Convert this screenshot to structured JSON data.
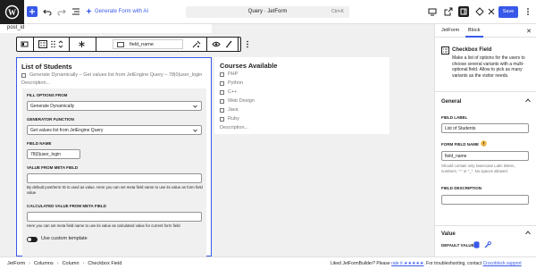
{
  "header": {
    "gen_ai_label": "Generate Form with AI",
    "command_title": "Query · JetForm",
    "command_shortcut": "Ctrl+K",
    "save_label": "Save"
  },
  "canvas": {
    "post_id_text": "post_id",
    "block_toolbar": {
      "field_name_value": "field_name"
    }
  },
  "main_field": {
    "title": "List of Students",
    "dynamic_label": "Generate Dynamically – Get values list from JetEngine Query – 78|0|user_login",
    "description_placeholder": "Description...",
    "fill_options_label": "FILL OPTIONS FROM",
    "fill_options_value": "Generate Dynamically",
    "generator_label": "GENERATOR FUNCTION",
    "generator_value": "Get values list from JetEngine Query",
    "field_name_label": "FIELD NAME",
    "field_name_value": "78|0|user_login",
    "meta_field_label": "VALUE FROM META FIELD",
    "meta_field_help": "By default post/term ID is used as value. Here you can set meta field name to use its value as form field value",
    "calc_label": "CALCULATED VALUE FROM META FIELD",
    "calc_help": "Here you can set meta field name to use its value as calculated value for current form field",
    "toggle_label": "Use custom template"
  },
  "courses_field": {
    "title": "Courses Available",
    "options": [
      "PHP",
      "Python",
      "C++",
      "Web Design",
      "Java",
      "Ruby"
    ],
    "description_placeholder": "Description..."
  },
  "sidebar": {
    "tabs": [
      "JetForm",
      "Block"
    ],
    "active_tab": "Block",
    "block_title": "Checkbox Field",
    "block_description": "Make a list of options for the users to choose several variants with a multi-optional field. Allow to pick as many variants as the visitor needs.",
    "general_title": "General",
    "field_label_caption": "FIELD LABEL",
    "field_label_value": "List of Students",
    "form_field_name_caption": "FORM FIELD NAME",
    "form_field_name_value": "field_name",
    "form_field_name_help": "Should contain only lowercase Latin letters, numbers, \"-\" or \"_\". No spaces allowed.",
    "field_description_caption": "FIELD DESCRIPTION",
    "value_title": "Value",
    "default_value_caption": "DEFAULT VALUE"
  },
  "statusbar": {
    "breadcrumbs": [
      "JetForm",
      "Columns",
      "Column",
      "Checkbox Field"
    ],
    "liked_text": "Liked JetFormBuilder? Please",
    "rate_link": "rate it ★★★★★",
    "troubleshoot_text": ". For troubleshooting, contact",
    "support_link": "Crocoblock support"
  },
  "colors": {
    "accent": "#3858e9",
    "warning": "#f0b849",
    "dark": "#1e1e1e"
  }
}
